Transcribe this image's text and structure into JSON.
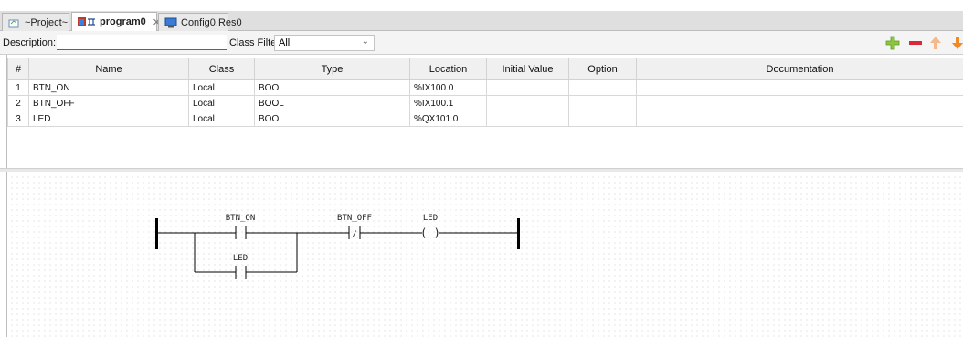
{
  "tabs": [
    {
      "label": "~Project~",
      "active": false,
      "closable": false,
      "icon": "project-icon"
    },
    {
      "label": "program0",
      "active": true,
      "closable": true,
      "icon": "ladder-program-icon"
    },
    {
      "label": "Config0.Res0",
      "active": false,
      "closable": false,
      "icon": "resource-icon"
    }
  ],
  "toolbar": {
    "description_label": "Description:",
    "description_value": "",
    "class_filter_label": "Class Filter:",
    "class_filter_value": "All",
    "add_icon": "plus-icon",
    "remove_icon": "minus-icon",
    "up_icon": "arrow-up-icon",
    "down_icon": "arrow-down-icon",
    "add_color": "#8cc63f",
    "remove_color": "#d9283a",
    "up_color": "#f4b88c",
    "down_color": "#f08a24"
  },
  "table": {
    "columns": [
      "#",
      "Name",
      "Class",
      "Type",
      "Location",
      "Initial Value",
      "Option",
      "Documentation"
    ],
    "rows": [
      [
        "1",
        "BTN_ON",
        "Local",
        "BOOL",
        "%IX100.0",
        "",
        "",
        ""
      ],
      [
        "2",
        "BTN_OFF",
        "Local",
        "BOOL",
        "%IX100.1",
        "",
        "",
        ""
      ],
      [
        "3",
        "LED",
        "Local",
        "BOOL",
        "%QX101.0",
        "",
        "",
        ""
      ]
    ]
  },
  "ladder": {
    "contact1": "BTN_ON",
    "contact2": "BTN_OFF",
    "coil": "LED",
    "parallel_contact": "LED",
    "coil_symbol": "( )",
    "negated_symbol": "/"
  }
}
